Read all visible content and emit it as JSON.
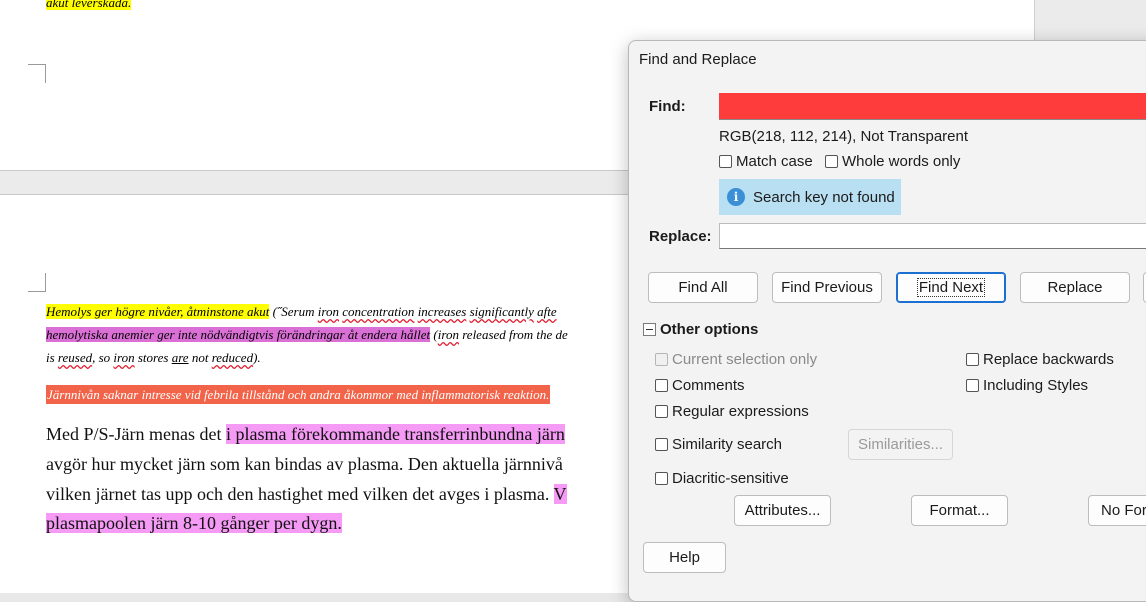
{
  "document": {
    "top_fragment": "akut leverskada.",
    "para1": {
      "line1_hl": "Hemolys ger högre nivåer, åtminstone akut",
      "line1_rest_a": " (˝Serum ",
      "line1_iron": "iron",
      "line1_space": " ",
      "line1_conc": "concentration",
      "line1_space2": " ",
      "line1_incr": "increases",
      "line1_space3": " ",
      "line1_sign": "significantly",
      "line1_space4": " ",
      "line1_after": "afte",
      "line2_hl": "hemolytiska anemier ger inte nödvändigtvis förändringar åt endera hållet",
      "line2_rest_a": " (",
      "line2_iron": "iron",
      "line2_rel": " released from the de",
      "line3_a": "is ",
      "line3_reused": "reused",
      "line3_b": ", so ",
      "line3_iron": "iron",
      "line3_c": " stores ",
      "line3_are": "are",
      "line3_d": " not ",
      "line3_reduced": "reduced",
      "line3_e": ")."
    },
    "para2": "Järnnivån saknar intresse vid febrila tillstånd och andra åkommor med inflammatorisk reaktion.",
    "para3": {
      "line1_a": "Med P/S-Järn menas det ",
      "line1_hl": "i plasma förekommande transferrinbundna järn",
      "line2": "avgör hur mycket järn som kan bindas av plasma. Den aktuella järnnivå",
      "line3_a": "vilken järnet tas upp  och den hastighet med vilken det avges i plasma. ",
      "line3_hl": "V",
      "line4_hl": "plasmapoolen järn 8-10 gånger per dygn."
    }
  },
  "dialog": {
    "title": "Find and Replace",
    "find_label": "Find:",
    "find_value": "",
    "find_attribute_text": "RGB(218, 112, 214), Not Transparent",
    "match_case": "Match case",
    "whole_words": "Whole words only",
    "notice": "Search key not found",
    "replace_label": "Replace:",
    "replace_value": "",
    "buttons": {
      "find_all": "Find All",
      "find_previous": "Find Previous",
      "find_next": "Find Next",
      "replace": "Replace"
    },
    "other_options": "Other options",
    "options": {
      "current_selection": "Current selection only",
      "comments": "Comments",
      "regex": "Regular expressions",
      "similarity": "Similarity search",
      "diacritic": "Diacritic-sensitive",
      "replace_backwards": "Replace backwards",
      "including_styles": "Including Styles"
    },
    "similarities_button": "Similarities...",
    "attributes_button": "Attributes...",
    "format_button": "Format...",
    "no_format_button": "No For",
    "help_button": "Help",
    "find_field_color": "#ff3c3c"
  }
}
